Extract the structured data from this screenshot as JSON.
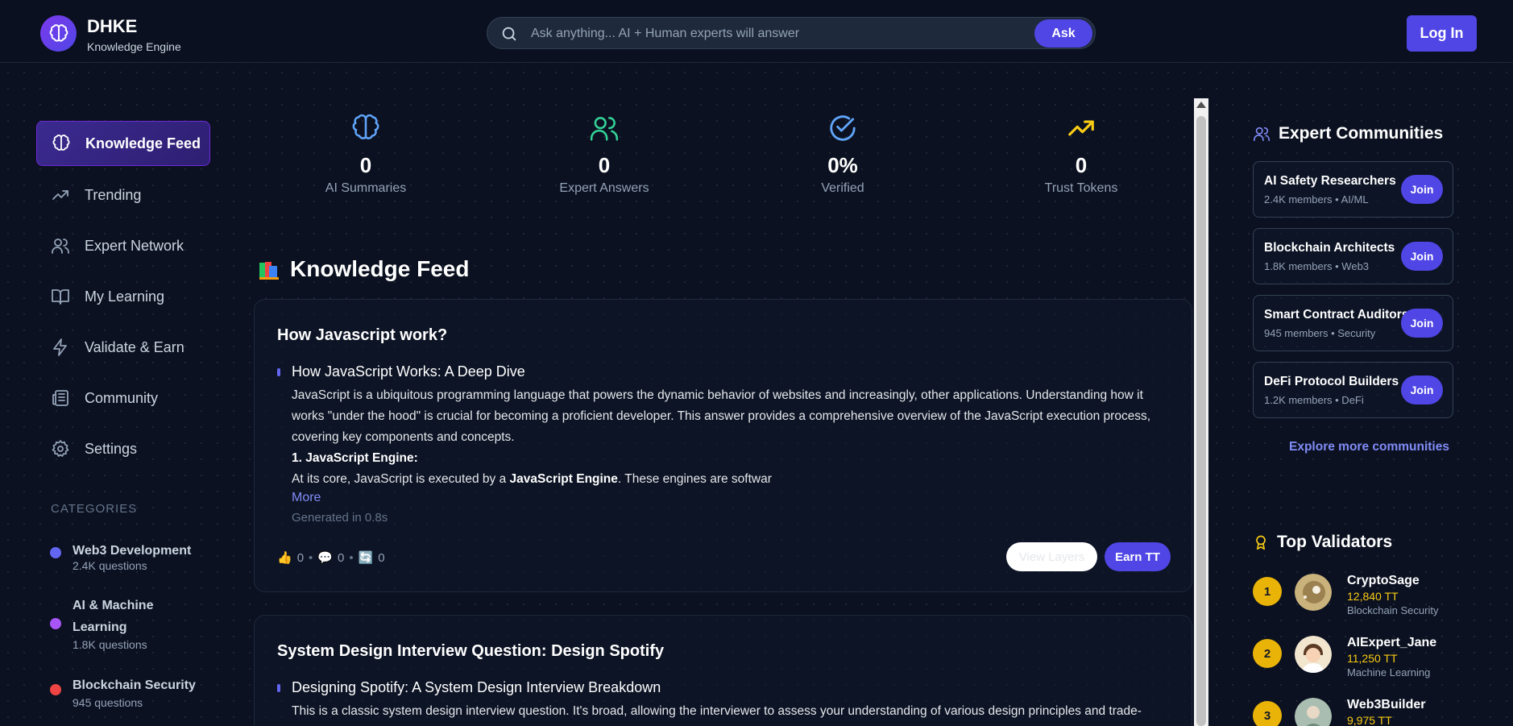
{
  "header": {
    "brand": "DHKE",
    "brand_sub": "Knowledge Engine",
    "search_placeholder": "Ask anything... AI + Human experts will answer",
    "ask_label": "Ask",
    "login_label": "Log In"
  },
  "sidebar": {
    "items": [
      {
        "label": "Knowledge Feed",
        "icon": "brain-icon",
        "active": true
      },
      {
        "label": "Trending",
        "icon": "trending-up-icon"
      },
      {
        "label": "Expert Network",
        "icon": "users-icon"
      },
      {
        "label": "My Learning",
        "icon": "book-icon"
      },
      {
        "label": "Validate & Earn",
        "icon": "bolt-icon"
      },
      {
        "label": "Community",
        "icon": "newspaper-icon"
      },
      {
        "label": "Settings",
        "icon": "gear-icon"
      }
    ],
    "categories_heading": "CATEGORIES",
    "categories": [
      {
        "name": "Web3 Development",
        "count": "2.4K questions",
        "color": "#6366f1"
      },
      {
        "name": "AI & Machine Learning",
        "count": "1.8K questions",
        "color": "#a855f7"
      },
      {
        "name": "Blockchain Security",
        "count": "945 questions",
        "color": "#ef4444"
      }
    ]
  },
  "stats": [
    {
      "value": "0",
      "label": "AI Summaries",
      "icon": "brain-icon",
      "color": "#60a5fa"
    },
    {
      "value": "0",
      "label": "Expert Answers",
      "icon": "users-icon",
      "color": "#34d399"
    },
    {
      "value": "0%",
      "label": "Verified",
      "icon": "check-circle-icon",
      "color": "#60a5fa"
    },
    {
      "value": "0",
      "label": "Trust Tokens",
      "icon": "trending-up-icon",
      "color": "#facc15"
    }
  ],
  "feed": {
    "title": "Knowledge Feed",
    "cards": [
      {
        "question": "How Javascript work?",
        "answer_title": "How JavaScript Works: A Deep Dive",
        "para": "JavaScript is a ubiquitous programming language that powers the dynamic behavior of websites and increasingly, other applications. Understanding how it works \"under the hood\" is crucial for becoming a proficient developer. This answer provides a comprehensive overview of the JavaScript execution process, covering key components and concepts.",
        "subheading": "1. JavaScript Engine:",
        "line_pre": "At its core, JavaScript is executed by a ",
        "line_bold": "JavaScript Engine",
        "line_post": ". These engines are softwar",
        "more": "More",
        "generated": "Generated in 0.8s",
        "likes": "0",
        "comments": "0",
        "shares": "0",
        "view_layers": "View Layers",
        "earn": "Earn TT"
      },
      {
        "question": "System Design Interview Question: Design Spotify",
        "answer_title": "Designing Spotify: A System Design Interview Breakdown",
        "para": "This is a classic system design interview question. It's broad, allowing the interviewer to assess your understanding of various design principles and trade-"
      }
    ]
  },
  "communities": {
    "title": "Expert Communities",
    "join_label": "Join",
    "items": [
      {
        "name": "AI Safety Researchers",
        "meta": "2.4K members • AI/ML"
      },
      {
        "name": "Blockchain Architects",
        "meta": "1.8K members • Web3"
      },
      {
        "name": "Smart Contract Auditors",
        "meta": "945 members • Security"
      },
      {
        "name": "DeFi Protocol Builders",
        "meta": "1.2K members • DeFi"
      }
    ],
    "explore": "Explore more communities"
  },
  "validators": {
    "title": "Top Validators",
    "items": [
      {
        "rank": "1",
        "name": "CryptoSage",
        "tokens": "12,840 TT",
        "spec": "Blockchain Security"
      },
      {
        "rank": "2",
        "name": "AIExpert_Jane",
        "tokens": "11,250 TT",
        "spec": "Machine Learning"
      },
      {
        "rank": "3",
        "name": "Web3Builder",
        "tokens": "9,975 TT",
        "spec": ""
      }
    ]
  },
  "colors": {
    "accent": "#4f46e5",
    "background": "#0b1120",
    "token_gold": "#facc15"
  }
}
